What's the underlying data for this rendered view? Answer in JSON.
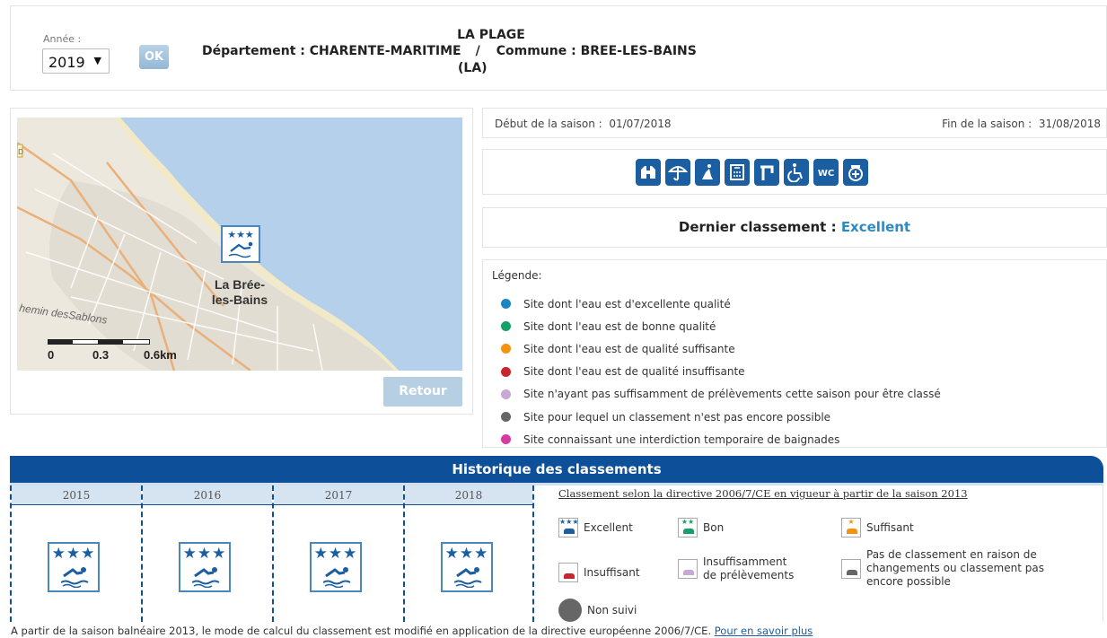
{
  "header": {
    "year_label": "Année :",
    "year_selected": "2019",
    "ok_label": "OK",
    "title": "LA PLAGE",
    "departement": "Département : CHARENTE-MARITIME",
    "separator": "/",
    "commune": "Commune : BREE-LES-BAINS",
    "commune_suffix": "(LA)"
  },
  "map": {
    "place_name_1": "La Brée-",
    "place_name_2": "les-Bains",
    "road_label": "hemin desSablons",
    "route_marker": "D",
    "scale": [
      "0",
      "0.3",
      "0.6km"
    ],
    "retour_label": "Retour"
  },
  "season": {
    "start_label": "Début de la saison :",
    "start_date": "01/07/2018",
    "end_label": "Fin de la saison :",
    "end_date": "31/08/2018"
  },
  "services": [
    "binoculars-icon",
    "parasol-icon",
    "lifeguard-icon",
    "shower-icon",
    "water-tap-icon",
    "wheelchair-icon",
    "wc-icon",
    "first-aid-icon"
  ],
  "classement": {
    "label": "Dernier classement :",
    "value": "Excellent"
  },
  "legend": {
    "title": "Légende:",
    "items": [
      {
        "color": "#1a86c2",
        "text": "Site dont l'eau est d'excellente qualité"
      },
      {
        "color": "#18a06a",
        "text": "Site dont l'eau est de bonne qualité"
      },
      {
        "color": "#f5930f",
        "text": "Site dont l'eau est de qualité suffisante"
      },
      {
        "color": "#c8262c",
        "text": "Site dont l'eau est de qualité insuffisante"
      },
      {
        "color": "#c9a8d6",
        "text": "Site n'ayant pas suffisamment de prélèvements cette saison pour être classé"
      },
      {
        "color": "#666666",
        "text": "Site pour lequel un classement n'est pas encore possible"
      },
      {
        "color": "#d63ba3",
        "text": "Site connaissant une interdiction temporaire de baignades"
      }
    ]
  },
  "history": {
    "title": "Historique des classements",
    "years": [
      "2015",
      "2016",
      "2017",
      "2018"
    ],
    "directive_text": "Classement selon la directive 2006/7/CE en vigueur à partir de la saison 2013",
    "legend": {
      "excellent": "Excellent",
      "bon": "Bon",
      "suffisant": "Suffisant",
      "insuffisant": "Insuffisant",
      "insuff_prel_1": "Insuffisamment",
      "insuff_prel_2": "de prélèvements",
      "pas_class_1": "Pas de classement en raison de",
      "pas_class_2": "changements ou classement pas",
      "pas_class_3": "encore possible",
      "non_suivi": "Non suivi"
    }
  },
  "footer": {
    "text": "A partir de la saison balnéaire 2013, le mode de calcul du classement est modifié en application de la directive européenne 2006/7/CE.",
    "link": "Pour en savoir plus"
  }
}
